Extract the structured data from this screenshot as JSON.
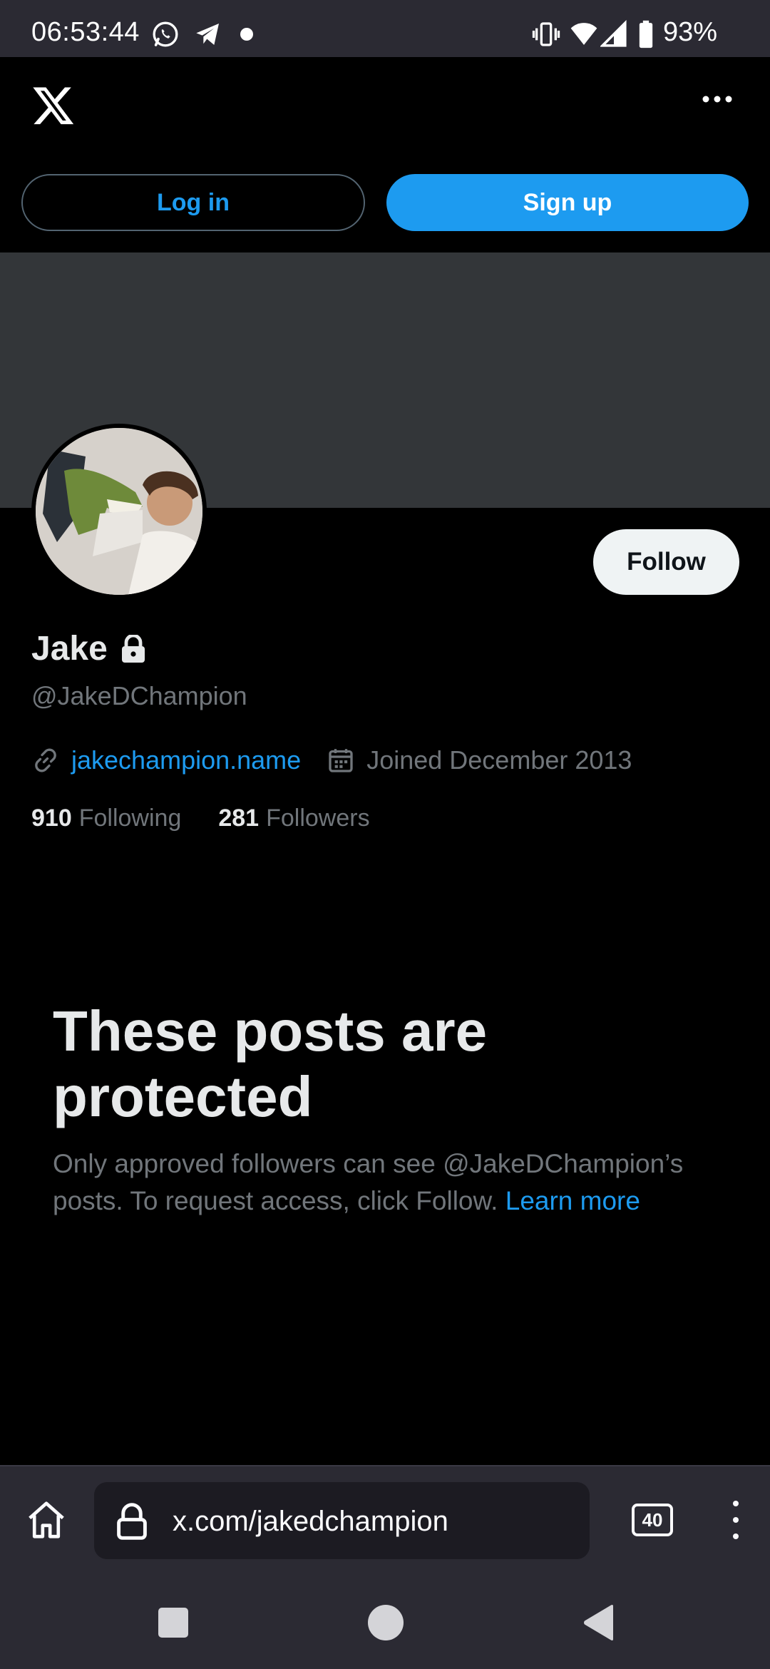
{
  "status_bar": {
    "time": "06:53:44",
    "battery": "93%",
    "icons": [
      "whatsapp-icon",
      "telegram-icon",
      "dot-icon",
      "vibrate-icon",
      "wifi-icon",
      "signal-icon",
      "battery-icon"
    ]
  },
  "header": {
    "logo": "x-logo-icon",
    "more_icon": "more-horizontal-icon",
    "login_label": "Log in",
    "signup_label": "Sign up"
  },
  "profile": {
    "name": "Jake",
    "handle": "@JakeDChampion",
    "website": "jakechampion.name",
    "joined": "Joined December 2013",
    "following_count": "910",
    "following_label": "Following",
    "followers_count": "281",
    "followers_label": "Followers",
    "follow_label": "Follow"
  },
  "protected": {
    "title": "These posts are protected",
    "body": "Only approved followers can see @JakeDChampion’s posts. To request access, click Follow.",
    "learn_more": "Learn more"
  },
  "browser": {
    "url": "x.com/jakedchampion",
    "tab_count": "40"
  },
  "colors": {
    "accent": "#1d9bf0",
    "background": "#000000",
    "banner": "#333639",
    "muted_text": "#71767b",
    "browser_chrome": "#2b2a33"
  }
}
